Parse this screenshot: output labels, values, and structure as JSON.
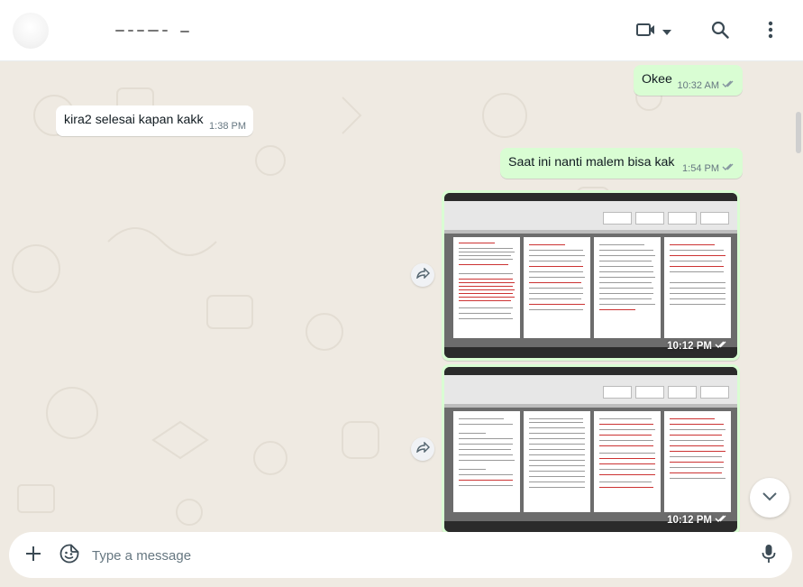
{
  "header": {
    "contact_name": "",
    "icons": {
      "video_call": "video-camera-icon",
      "dropdown": "caret-down-icon",
      "search": "search-icon",
      "menu": "kebab-menu-icon"
    }
  },
  "messages": [
    {
      "direction": "outgoing",
      "text": "Okee",
      "time": "10:32 AM",
      "status": "read"
    },
    {
      "direction": "incoming",
      "text": "kira2 selesai kapan kakk",
      "time": "1:38 PM"
    },
    {
      "direction": "outgoing",
      "text": "Saat ini nanti malem bisa kak",
      "time": "1:54 PM",
      "status": "read"
    },
    {
      "direction": "outgoing",
      "type": "image",
      "description": "screenshot of a document editor",
      "time": "10:12 PM",
      "status": "read"
    },
    {
      "direction": "outgoing",
      "type": "image",
      "description": "screenshot of a document editor",
      "time": "10:12 PM",
      "status": "read"
    }
  ],
  "footer": {
    "placeholder": "Type a message",
    "icons": {
      "attach": "plus-icon",
      "sticker": "sticker-icon",
      "mic": "microphone-icon"
    }
  },
  "colors": {
    "outgoing_bubble": "#d9fdd3",
    "incoming_bubble": "#ffffff",
    "read_tick": "#53bdeb",
    "chat_background": "#efeae2"
  }
}
